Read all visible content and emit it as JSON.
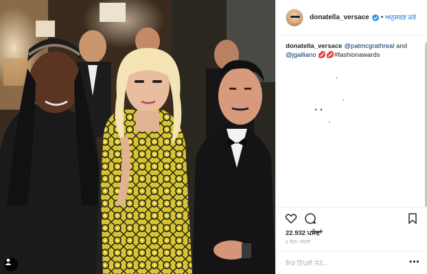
{
  "post": {
    "image_alt": "",
    "account": {
      "username": "donatella_versace",
      "separator": "•",
      "follow_label": "ਅਨੁਸਰਣ ਕਰੋ"
    },
    "caption": {
      "username": "donatella_versace",
      "mention_1": "@patmcgrathreal",
      "conjunction": " and ",
      "mention_2": "@jgalliano",
      "rest": " 💋💋#fashionawards"
    },
    "likes": "22.932 ਪਸੰਦਾਂ",
    "timestamp": "2 ਦਿਨ ਪਹਿਲਾਂ",
    "comment_placeholder": "ਇਕ ਟਿੱਪਣੀ ਜੋੜੋ...",
    "more_label": "•••"
  },
  "colors": {
    "accent": "#3897f0",
    "text": "#262626",
    "muted": "#999999",
    "divider": "#efefef"
  },
  "icons": [
    "tagged-user-icon",
    "verified-badge-icon",
    "heart-icon",
    "comment-icon",
    "bookmark-icon",
    "more-options-icon"
  ]
}
